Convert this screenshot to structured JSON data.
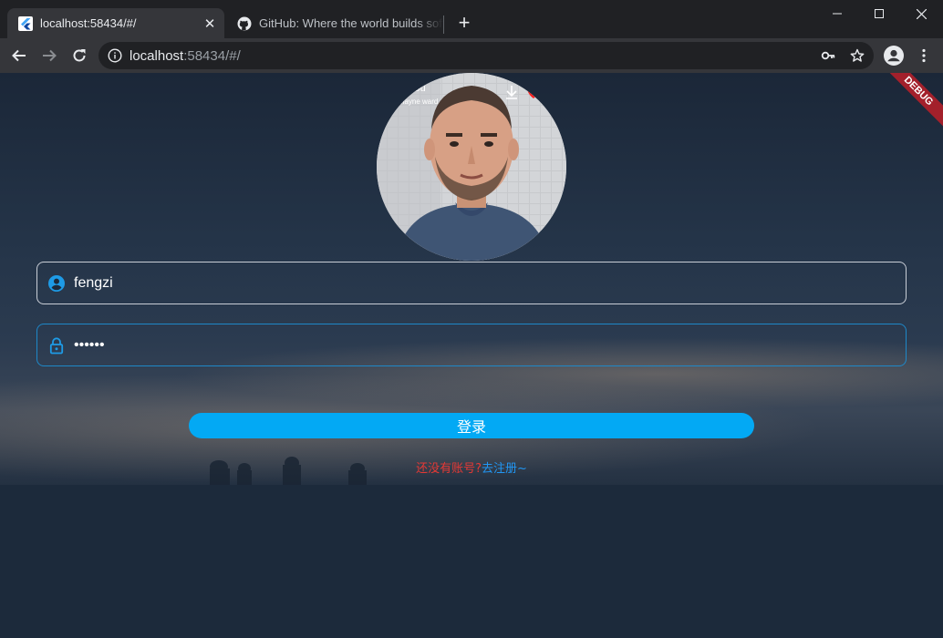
{
  "browser": {
    "tabs": [
      {
        "title": "localhost:58434/#/",
        "active": true,
        "icon": "flutter-icon"
      },
      {
        "title": "GitHub: Where the world builds software",
        "active": false,
        "icon": "github-icon"
      }
    ],
    "address": {
      "host": "localhost",
      "rest": ":58434/#/"
    }
  },
  "app": {
    "debug_banner": "DEBUG",
    "avatar_overlay": {
      "song": "all you",
      "artist": "shayne ward"
    },
    "username": {
      "value": "fengzi",
      "icon": "account-circle-icon"
    },
    "password": {
      "value": "••••••",
      "icon": "lock-icon"
    },
    "login_label": "登录",
    "register_question": "还没有账号?",
    "register_link": "去注册~"
  },
  "colors": {
    "accent": "#03a9f4",
    "link": "#2196f3",
    "question": "#e53935",
    "debug": "#a3202b"
  }
}
